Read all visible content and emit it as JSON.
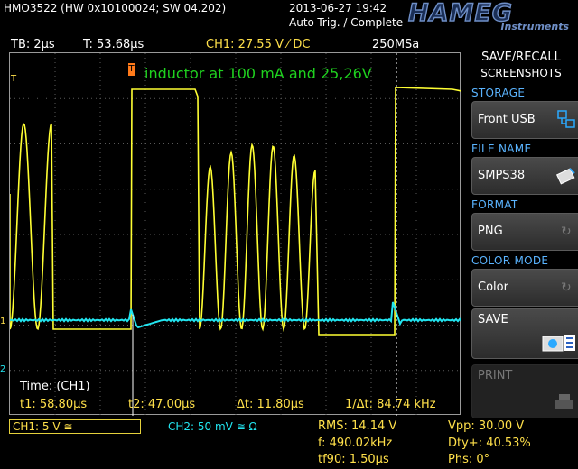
{
  "header": {
    "model": "HMO3522 (HW 0x10100024; SW 04.202)",
    "datetime": "2013-06-27 19:42",
    "trigger_status": "Auto-Trig. / Complete",
    "logo_main": "HAMEG",
    "logo_sub": "Instruments"
  },
  "status": {
    "timebase": "TB: 2µs",
    "trigger_time": "T: 53.68µs",
    "ch1": "CH1: 27.55 V ⁄ DC",
    "sample_rate": "250MSa"
  },
  "screen": {
    "annotation": "inductor at 100 mA and 25,26V",
    "trigger_marker": "T",
    "ch1_marker": "1",
    "ch2_marker": "2",
    "trig_level_marker": "T"
  },
  "cursor": {
    "title": "Time: (CH1)",
    "t1": "t1: 58.80µs",
    "t2": "t2: 47.00µs",
    "dt": "Δt: 11.80µs",
    "inv_dt": "1/Δt: 84.74 kHz"
  },
  "channels": {
    "ch1": "CH1: 5 V ≅",
    "ch2": "CH2: 50 mV ≅ Ω"
  },
  "measurements": {
    "rms": "RMS: 14.14 V",
    "freq": "f: 490.02kHz",
    "tf90": "tf90: 1.50µs",
    "vpp": "Vpp: 30.00 V",
    "duty": "Dty+: 40.53%",
    "phase": "Phs: 0°"
  },
  "panel": {
    "title_line1": "SAVE/RECALL",
    "title_line2": "SCREENSHOTS",
    "storage_label": "STORAGE",
    "storage_value": "Front USB",
    "filename_label": "FILE NAME",
    "filename_value": "SMPS38",
    "format_label": "FORMAT",
    "format_value": "PNG",
    "colormode_label": "COLOR MODE",
    "colormode_value": "Color",
    "save_label": "SAVE",
    "print_label": "PRINT"
  },
  "colors": {
    "ch1_trace": "#ffff33",
    "ch2_trace": "#22e5f0",
    "annotation": "#1fd21f",
    "accent_blue": "#5ab4ff"
  }
}
